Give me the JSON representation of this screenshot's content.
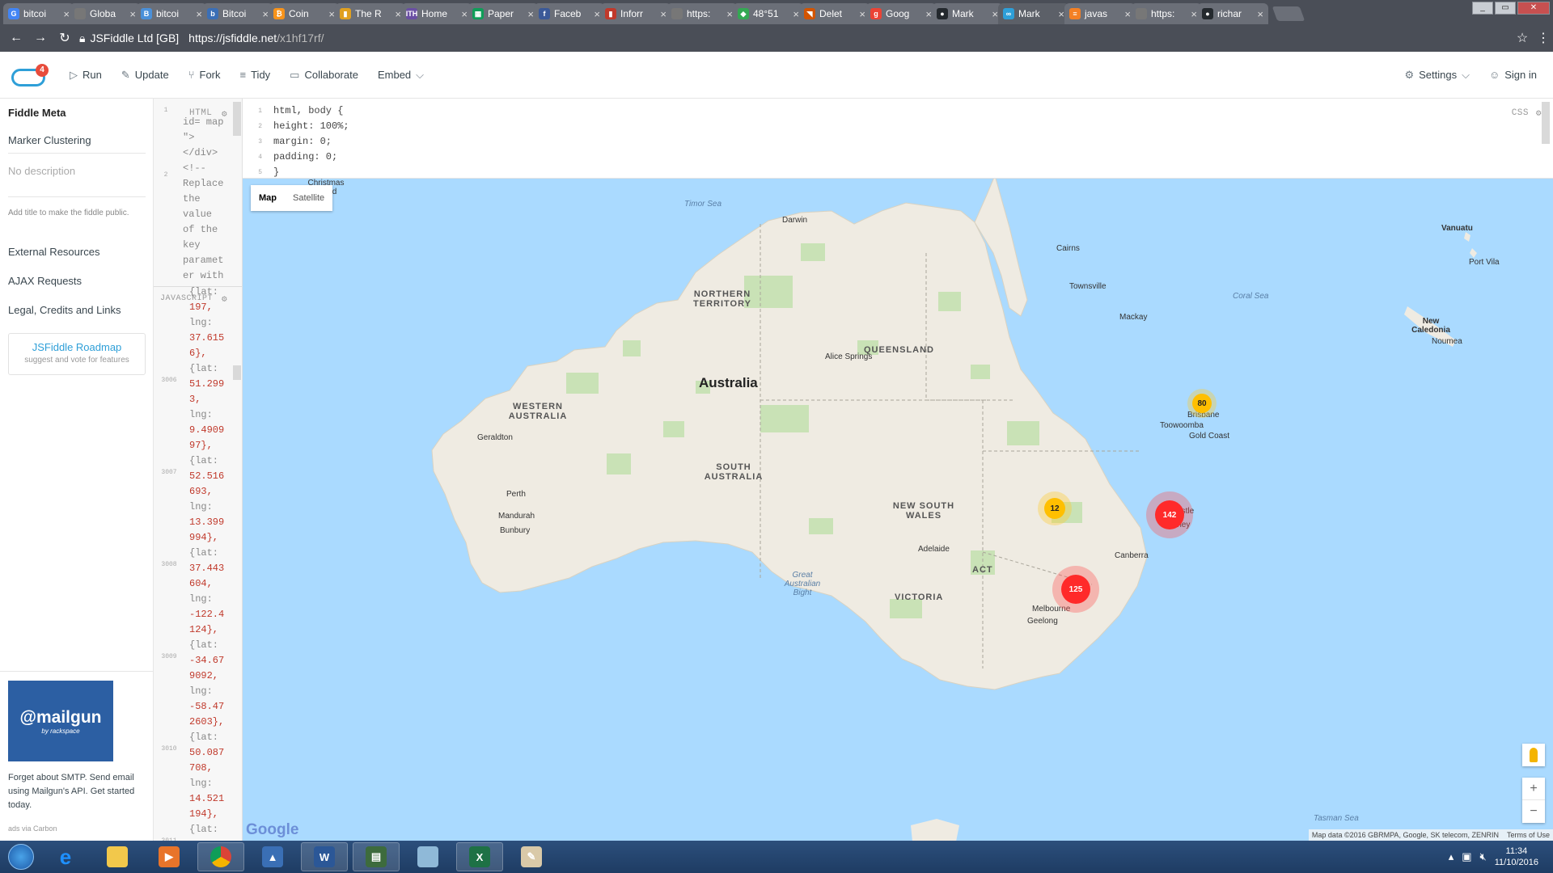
{
  "browser": {
    "tabs": [
      {
        "label": "bitcoi",
        "icon": "google-icon",
        "color": "#4285f4",
        "glyph": "G"
      },
      {
        "label": "Globa",
        "icon": "page-icon",
        "color": "#777777",
        "glyph": ""
      },
      {
        "label": "bitcoi",
        "icon": "blog-icon",
        "color": "#4a90d9",
        "glyph": "B"
      },
      {
        "label": "Bitcoi",
        "icon": "bitcoin-site-icon",
        "color": "#3b6fb6",
        "glyph": "b"
      },
      {
        "label": "Coin",
        "icon": "bitcoin-icon",
        "color": "#f7931a",
        "glyph": "₿"
      },
      {
        "label": "The R",
        "icon": "bars-icon",
        "color": "#e0a020",
        "glyph": "▮"
      },
      {
        "label": "Home",
        "icon": "ith-icon",
        "color": "#6a4fa3",
        "glyph": "ITH"
      },
      {
        "label": "Paper",
        "icon": "sheets-icon",
        "color": "#0f9d58",
        "glyph": "▦"
      },
      {
        "label": "Faceb",
        "icon": "facebook-icon",
        "color": "#3b5998",
        "glyph": "f"
      },
      {
        "label": "Inforr",
        "icon": "info-icon",
        "color": "#c0392b",
        "glyph": "▮"
      },
      {
        "label": "https:",
        "icon": "page-icon",
        "color": "#777777",
        "glyph": ""
      },
      {
        "label": "48°51",
        "icon": "maps-icon",
        "color": "#34a853",
        "glyph": "◆"
      },
      {
        "label": "Delet",
        "icon": "pdf-icon",
        "color": "#d35400",
        "glyph": "◥"
      },
      {
        "label": "Goog",
        "icon": "google-search-icon",
        "color": "#ea4335",
        "glyph": "g"
      },
      {
        "label": "Mark",
        "icon": "github-icon",
        "color": "#24292e",
        "glyph": "●"
      },
      {
        "label": "Mark",
        "icon": "jsfiddle-icon",
        "color": "#2e9fd8",
        "glyph": "∞"
      },
      {
        "label": "javas",
        "icon": "stackoverflow-icon",
        "color": "#f48024",
        "glyph": "≡"
      },
      {
        "label": "https:",
        "icon": "page-icon",
        "color": "#777777",
        "glyph": ""
      },
      {
        "label": "richar",
        "icon": "github-icon",
        "color": "#24292e",
        "glyph": "●"
      }
    ],
    "active_tab": 15,
    "security_label": "JSFiddle Ltd [GB]",
    "url_host": "https://jsfiddle.net",
    "url_path": "/x1hf17rf/"
  },
  "header": {
    "badge_count": "4",
    "run": "Run",
    "update": "Update",
    "fork": "Fork",
    "tidy": "Tidy",
    "collaborate": "Collaborate",
    "embed": "Embed",
    "settings": "Settings",
    "signin": "Sign in"
  },
  "sidebar": {
    "title": "Fiddle Meta",
    "fiddle_name": "Marker Clustering",
    "description_placeholder": "No description",
    "hint": "Add title to make the fiddle public.",
    "external_resources": "External Resources",
    "ajax_requests": "AJAX Requests",
    "legal": "Legal, Credits and Links",
    "roadmap_title": "JSFiddle Roadmap",
    "roadmap_sub": "suggest and vote for features",
    "ad_brand": "@mailgun",
    "ad_brand_sub": "by rackspace",
    "ad_text": "Forget about SMTP. Send email using Mailgun's API. Get started today.",
    "ad_via": "ads via Carbon"
  },
  "html_panel": {
    "tag": "HTML",
    "lines": [
      "id= map",
      "\">",
      "</div>",
      "<!--",
      "Replace",
      "the",
      "value",
      "of the",
      "key",
      "paramet",
      "er with"
    ],
    "gutter": [
      "1",
      "2"
    ]
  },
  "js_panel": {
    "tag": "JAVASCRIPT",
    "lines": [
      "{lat:",
      "197,",
      "lng:",
      "37.615",
      "6},",
      "{lat:",
      "51.299",
      "3,",
      "lng:",
      "9.4909",
      "97},",
      "{lat:",
      "52.516",
      "693,",
      "lng:",
      "13.399",
      "994},",
      "{lat:",
      "37.443",
      "604,",
      "lng:",
      "-122.4",
      "124},",
      "{lat:",
      "-34.67",
      "9092,",
      "lng:",
      "-58.47",
      "2603},",
      "{lat:",
      "50.087",
      "708,",
      "lng:",
      "14.521",
      "194},",
      "{lat:"
    ],
    "gutter": [
      "3006",
      "3007",
      "3008",
      "3009",
      "3010",
      "3011"
    ]
  },
  "css_panel": {
    "tag": "CSS",
    "lines": [
      {
        "n": "1",
        "text": "html, body {"
      },
      {
        "n": "2",
        "text": "  height: 100%;"
      },
      {
        "n": "3",
        "text": "  margin: 0;"
      },
      {
        "n": "4",
        "text": "  padding: 0;"
      },
      {
        "n": "5",
        "text": "}"
      }
    ]
  },
  "map": {
    "type_map": "Map",
    "type_satellite": "Satellite",
    "labels": {
      "australia": "Australia",
      "nt": "NORTHERN TERRITORY",
      "wa": "WESTERN AUSTRALIA",
      "sa": "SOUTH AUSTRALIA",
      "qld": "QUEENSLAND",
      "nsw": "NEW SOUTH WALES",
      "vic": "VICTORIA",
      "act": "ACT",
      "timor_sea": "Timor Sea",
      "coral_sea": "Coral Sea",
      "tasman_sea": "Tasman Sea",
      "bight": "Great Australian Bight",
      "christmas": "Christmas Island",
      "vanuatu": "Vanuatu",
      "port_vila": "Port Vila",
      "new_caledonia": "New Caledonia",
      "noumea": "Noumea",
      "darwin": "Darwin",
      "cairns": "Cairns",
      "townsville": "Townsville",
      "mackay": "Mackay",
      "alice": "Alice Springs",
      "brisbane": "Brisbane",
      "toowoomba": "Toowoomba",
      "gold_coast": "Gold Coast",
      "geraldton": "Geraldton",
      "perth": "Perth",
      "mandurah": "Mandurah",
      "bunbury": "Bunbury",
      "adelaide": "Adelaide",
      "newcastle": "Newcastle",
      "sydney": "Sydney",
      "canberra": "Canberra",
      "melbourne": "Melbourne",
      "geelong": "Geelong"
    },
    "clusters": [
      {
        "count": "80",
        "level": "yellow"
      },
      {
        "count": "12",
        "level": "yellow"
      },
      {
        "count": "142",
        "level": "red"
      },
      {
        "count": "125",
        "level": "red"
      }
    ],
    "google": "Google",
    "attribution": "Map data ©2016 GBRMPA, Google, SK telecom, ZENRIN",
    "terms": "Terms of Use"
  },
  "taskbar": {
    "time": "11:34",
    "date": "11/10/2016"
  }
}
